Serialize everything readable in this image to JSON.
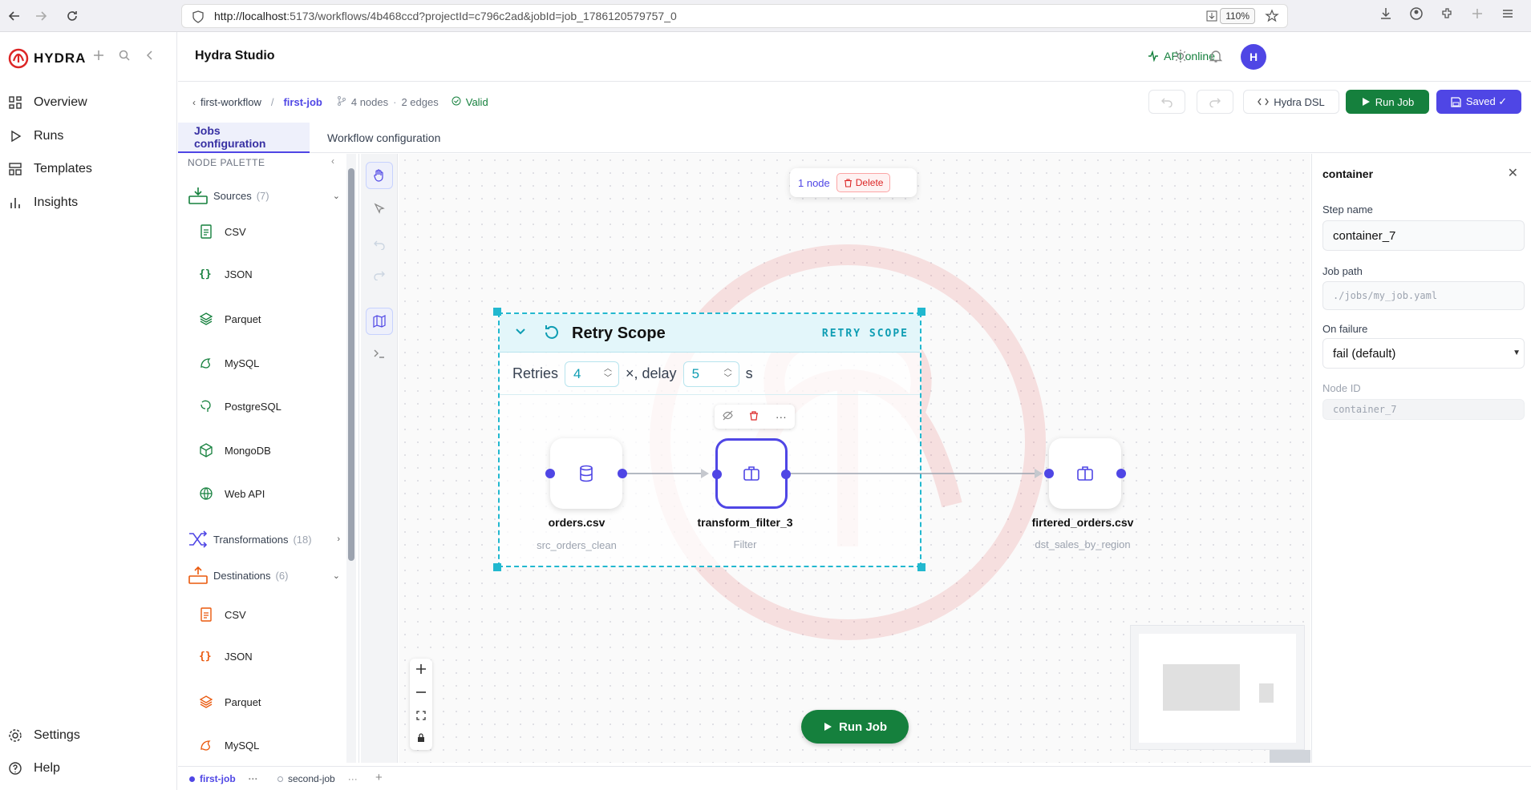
{
  "browser": {
    "url_host": "http://localhost",
    "url_rest": ":5173/workflows/4b468ccd?projectId=c796c2ad&jobId=job_1786120579757_0",
    "zoom": "110%"
  },
  "brand": {
    "name": "HYDRA"
  },
  "nav": {
    "items": [
      {
        "label": "Overview"
      },
      {
        "label": "Runs"
      },
      {
        "label": "Templates"
      },
      {
        "label": "Insights"
      }
    ],
    "bottom": [
      {
        "label": "Settings"
      },
      {
        "label": "Help"
      }
    ]
  },
  "header": {
    "title": "Hydra Studio",
    "api_status": "API online",
    "avatar_initial": "H"
  },
  "breadcrumb": {
    "workflow": "first-workflow",
    "separator": "/",
    "job": "first-job",
    "nodes": "4 nodes",
    "dot": "·",
    "edges": "2 edges",
    "valid": "Valid"
  },
  "toolbar": {
    "dsl_label": "Hydra DSL",
    "run_label": "Run Job",
    "saved_label": "Saved ✓"
  },
  "tabs": [
    {
      "label": "Jobs configuration",
      "active": true
    },
    {
      "label": "Workflow configuration",
      "active": false
    }
  ],
  "palette": {
    "title": "NODE PALETTE",
    "sources": {
      "label": "Sources",
      "count": "(7)",
      "items": [
        "CSV",
        "JSON",
        "Parquet",
        "MySQL",
        "PostgreSQL",
        "MongoDB",
        "Web API"
      ]
    },
    "transformations": {
      "label": "Transformations",
      "count": "(18)"
    },
    "destinations": {
      "label": "Destinations",
      "count": "(6)",
      "items": [
        "CSV",
        "JSON",
        "Parquet",
        "MySQL"
      ]
    }
  },
  "canvas": {
    "selection": {
      "count": "1 node",
      "delete_label": "Delete"
    },
    "scope": {
      "title": "Retry Scope",
      "tag": "RETRY SCOPE",
      "retries_label": "Retries",
      "retries_value": "4",
      "delay_label": "×, delay",
      "delay_value": "5",
      "unit": "s"
    },
    "nodes": [
      {
        "label": "orders.csv",
        "sub": "src_orders_clean"
      },
      {
        "label": "transform_filter_3",
        "sub": "Filter"
      },
      {
        "label": "firtered_orders.csv",
        "sub": "dst_sales_by_region"
      }
    ],
    "run_label": "Run Job"
  },
  "inspector": {
    "title": "container",
    "step_name_label": "Step name",
    "step_name_value": "container_7",
    "job_path_label": "Job path",
    "job_path_placeholder": "./jobs/my_job.yaml",
    "on_failure_label": "On failure",
    "on_failure_value": "fail (default)",
    "node_id_label": "Node ID",
    "node_id_value": "container_7"
  },
  "jobtabs": [
    {
      "label": "first-job",
      "active": true
    },
    {
      "label": "second-job",
      "active": false
    }
  ],
  "colors": {
    "accent": "#4f46e5",
    "success": "#15803d",
    "scope": "#22b8cf",
    "danger": "#dc2626"
  }
}
